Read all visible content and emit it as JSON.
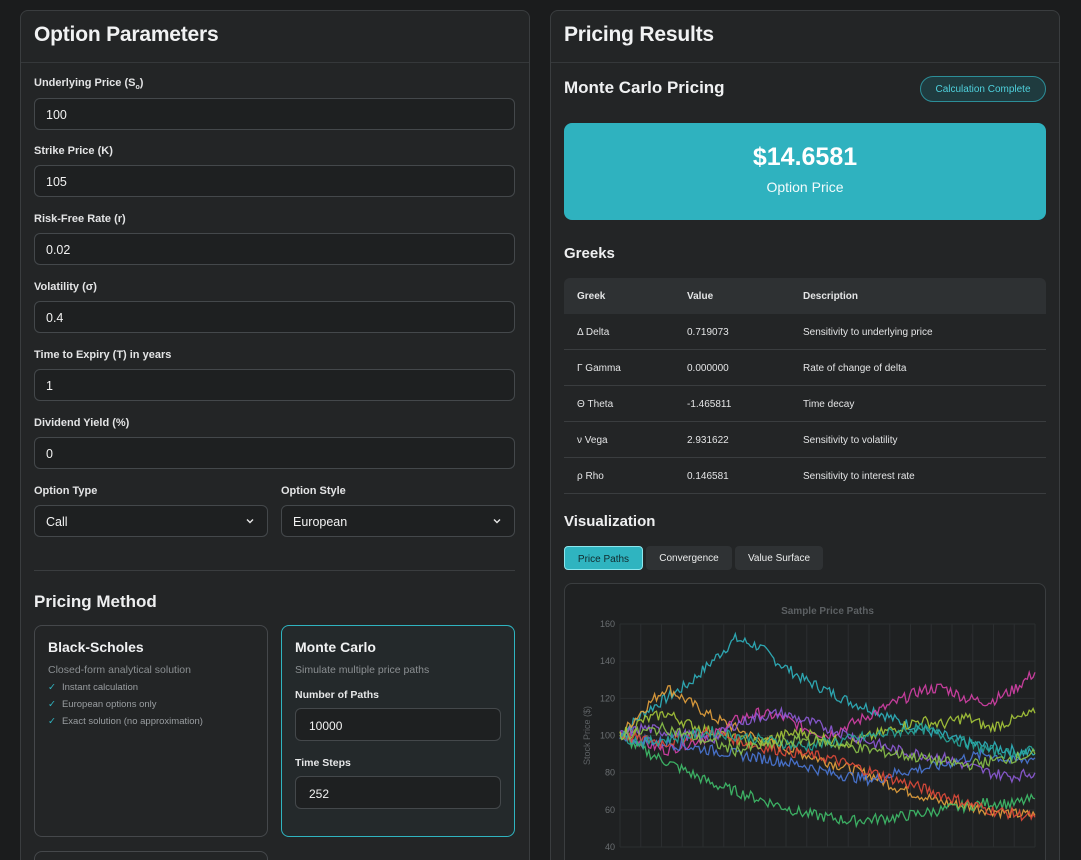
{
  "params": {
    "title": "Option Parameters",
    "fields": [
      {
        "label": "Underlying Price (S",
        "sub": "o",
        "tail": ")",
        "value": "100"
      },
      {
        "label": "Strike Price (K)",
        "value": "105"
      },
      {
        "label": "Risk-Free Rate (r)",
        "value": "0.02"
      },
      {
        "label": "Volatility (σ)",
        "value": "0.4"
      },
      {
        "label": "Time to Expiry (T) in years",
        "value": "1"
      },
      {
        "label": "Dividend Yield (%)",
        "value": "0"
      }
    ],
    "option_type": {
      "label": "Option Type",
      "value": "Call"
    },
    "option_style": {
      "label": "Option Style",
      "value": "European"
    }
  },
  "method": {
    "title": "Pricing Method",
    "black_scholes": {
      "title": "Black-Scholes",
      "subtitle": "Closed-form analytical solution",
      "features": [
        "Instant calculation",
        "European options only",
        "Exact solution (no approximation)"
      ]
    },
    "monte_carlo": {
      "title": "Monte Carlo",
      "subtitle": "Simulate multiple price paths",
      "paths_label": "Number of Paths",
      "paths_value": "10000",
      "steps_label": "Time Steps",
      "steps_value": "252"
    }
  },
  "results": {
    "title": "Pricing Results",
    "method_title": "Monte Carlo Pricing",
    "status_badge": "Calculation Complete",
    "price": "$14.6581",
    "price_label": "Option Price",
    "greeks_title": "Greeks",
    "greeks_headers": [
      "Greek",
      "Value",
      "Description"
    ],
    "greeks": [
      {
        "name": "Δ Delta",
        "value": "0.719073",
        "description": "Sensitivity to underlying price"
      },
      {
        "name": "Γ Gamma",
        "value": "0.000000",
        "description": "Rate of change of delta"
      },
      {
        "name": "Θ Theta",
        "value": "-1.465811",
        "description": "Time decay"
      },
      {
        "name": "ν Vega",
        "value": "2.931622",
        "description": "Sensitivity to volatility"
      },
      {
        "name": "ρ Rho",
        "value": "0.146581",
        "description": "Sensitivity to interest rate"
      }
    ],
    "viz_title": "Visualization",
    "viz_tabs": [
      "Price Paths",
      "Convergence",
      "Value Surface"
    ],
    "active_tab": "Price Paths"
  },
  "colors": {
    "accent": "#2fb4c0"
  },
  "chart_data": {
    "type": "line",
    "title": "Sample Price Paths",
    "ylabel": "Stock Price ($)",
    "xlabel": "",
    "ylim": [
      40,
      160
    ],
    "yticks": [
      40,
      60,
      80,
      100,
      120,
      140,
      160
    ],
    "grid": true,
    "series": [
      {
        "color": "#2fb4c0",
        "values": [
          100,
          112,
          120,
          128,
          140,
          152,
          148,
          138,
          130,
          124,
          118,
          114,
          108,
          104,
          100,
          96,
          94,
          92,
          90
        ]
      },
      {
        "color": "#e8a33d",
        "values": [
          100,
          114,
          126,
          118,
          110,
          104,
          98,
          94,
          90,
          86,
          82,
          78,
          72,
          68,
          64,
          62,
          60,
          58,
          57
        ]
      },
      {
        "color": "#d640a8",
        "values": [
          100,
          96,
          92,
          96,
          100,
          108,
          112,
          110,
          104,
          100,
          106,
          112,
          118,
          124,
          126,
          120,
          118,
          124,
          134
        ]
      },
      {
        "color": "#3fbf6a",
        "values": [
          100,
          92,
          86,
          80,
          74,
          70,
          66,
          62,
          58,
          56,
          54,
          55,
          56,
          58,
          60,
          62,
          64,
          63,
          66
        ]
      },
      {
        "color": "#a7c93a",
        "values": [
          100,
          108,
          112,
          106,
          102,
          98,
          96,
          100,
          102,
          98,
          96,
          100,
          104,
          108,
          106,
          110,
          104,
          108,
          112
        ]
      },
      {
        "color": "#4a78d8",
        "values": [
          100,
          98,
          96,
          94,
          92,
          90,
          88,
          86,
          84,
          80,
          78,
          76,
          80,
          82,
          84,
          88,
          90,
          86,
          88
        ]
      },
      {
        "color": "#e04a3a",
        "values": [
          100,
          98,
          96,
          100,
          102,
          98,
          94,
          92,
          90,
          88,
          84,
          80,
          76,
          72,
          68,
          64,
          60,
          58,
          56
        ]
      },
      {
        "color": "#8e5bd8",
        "values": [
          100,
          104,
          102,
          100,
          98,
          106,
          110,
          112,
          108,
          104,
          100,
          96,
          92,
          90,
          88,
          84,
          80,
          78,
          80
        ]
      },
      {
        "color": "#26a69a",
        "values": [
          100,
          96,
          98,
          100,
          102,
          100,
          98,
          96,
          94,
          96,
          98,
          100,
          102,
          104,
          100,
          96,
          92,
          90,
          92
        ]
      },
      {
        "color": "#8bc34a",
        "values": [
          100,
          102,
          104,
          100,
          96,
          92,
          94,
          96,
          98,
          96,
          94,
          92,
          90,
          88,
          86,
          84,
          86,
          88,
          90
        ]
      }
    ]
  }
}
